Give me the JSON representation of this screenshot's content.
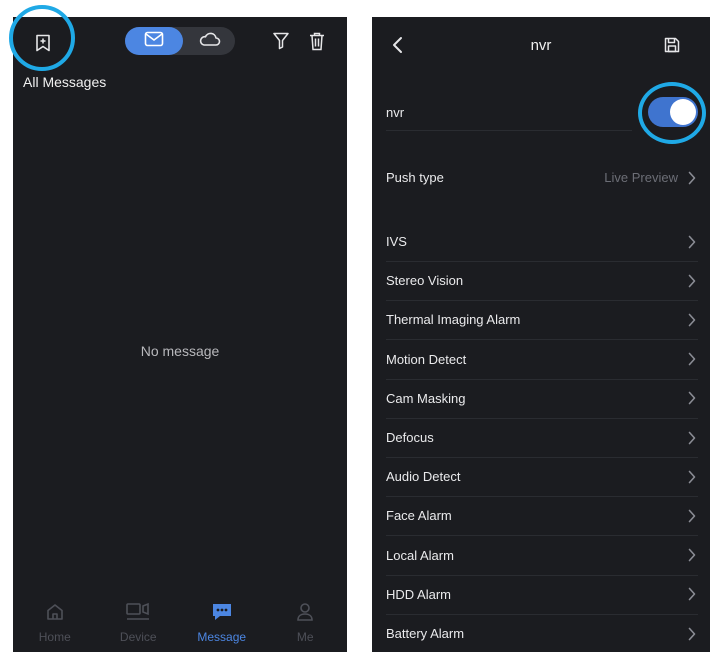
{
  "left": {
    "header_title": "All Messages",
    "empty_text": "No message",
    "tabs": [
      {
        "label": "Home",
        "icon": "home-icon",
        "active": false
      },
      {
        "label": "Device",
        "icon": "device-icon",
        "active": false
      },
      {
        "label": "Message",
        "icon": "message-icon",
        "active": true
      },
      {
        "label": "Me",
        "icon": "person-icon",
        "active": false
      }
    ]
  },
  "right": {
    "title": "nvr",
    "device_name": "nvr",
    "toggle_on": true,
    "push_type": {
      "label": "Push type",
      "value": "Live Preview"
    },
    "alarms": [
      "IVS",
      "Stereo Vision",
      "Thermal Imaging Alarm",
      "Motion Detect",
      "Cam Masking",
      "Defocus",
      "Audio Detect",
      "Face Alarm",
      "Local Alarm",
      "HDD Alarm",
      "Battery Alarm"
    ]
  },
  "colors": {
    "background": "#1b1c20",
    "accent": "#4c86e2",
    "highlight_ring": "#1fa9e6",
    "toggle_on": "#3f74cf"
  }
}
